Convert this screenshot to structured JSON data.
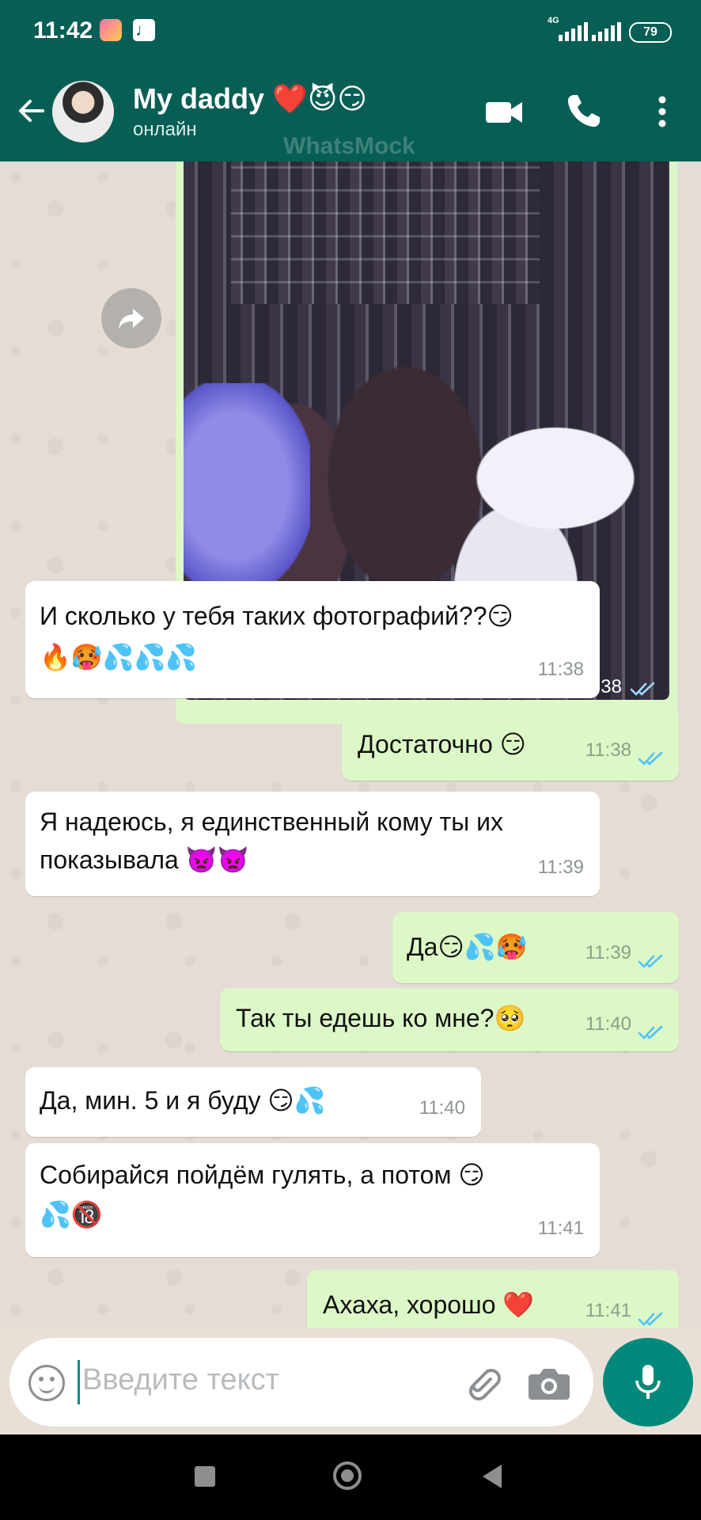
{
  "status_bar": {
    "time": "11:42",
    "network": "4G",
    "battery": "79"
  },
  "header": {
    "contact_name": "My daddy ❤️😈😏",
    "contact_status": "онлайн",
    "watermark": "WhatsMock"
  },
  "photo_message": {
    "time": "11:38",
    "status": "read"
  },
  "messages": [
    {
      "direction": "in",
      "line1": "И сколько у тебя таких фотографий??😏",
      "line2": "🔥🥵💦💦💦",
      "time": "11:38"
    },
    {
      "direction": "out",
      "line1": "Достаточно 😏",
      "time": "11:38",
      "status": "read"
    },
    {
      "direction": "in",
      "line1": "Я надеюсь, я единственный кому ты их",
      "line2": "показывала 👿👿",
      "time": "11:39"
    },
    {
      "direction": "out",
      "line1": "Да😏💦🥵",
      "time": "11:39",
      "status": "read"
    },
    {
      "direction": "out",
      "line1": "Так ты едешь ко мне?🥺",
      "time": "11:40",
      "status": "read"
    },
    {
      "direction": "in",
      "line1": "Да, мин. 5 и я буду 😏💦",
      "time": "11:40"
    },
    {
      "direction": "in",
      "line1": "Собирайся пойдём гулять, а потом 😏",
      "line2": "💦🔞",
      "time": "11:41"
    },
    {
      "direction": "out",
      "line1": "Ахаха, хорошо ❤️",
      "time": "11:41",
      "status": "read"
    }
  ],
  "composer": {
    "placeholder": "Введите текст"
  },
  "icons": {
    "back": "arrow-left-icon",
    "video": "video-call-icon",
    "call": "phone-icon",
    "menu": "more-vertical-icon",
    "forward": "forward-icon",
    "emoji": "emoji-icon",
    "attach": "paperclip-icon",
    "camera": "camera-icon",
    "mic": "mic-icon"
  },
  "colors": {
    "header": "#075e54",
    "outgoing": "#dcf8c6",
    "incoming": "#ffffff",
    "read_ticks": "#4fc3f7",
    "mic_button": "#00897b"
  }
}
